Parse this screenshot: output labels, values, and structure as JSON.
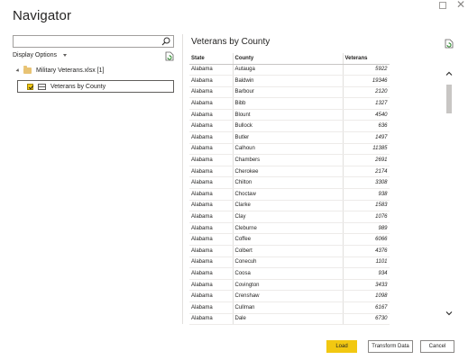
{
  "window": {
    "title": "Navigator",
    "maximize_glyph": "",
    "close_glyph": "✕"
  },
  "search": {
    "placeholder": "",
    "value": ""
  },
  "display_options": {
    "label": "Display Options"
  },
  "tree": {
    "folder_label": "Military Veterans.xlsx [1]",
    "item_label": "Veterans by County",
    "item_checked": true
  },
  "preview": {
    "title": "Veterans by County",
    "columns": [
      "State",
      "County",
      "Veterans"
    ],
    "rows": [
      [
        "Alabama",
        "Autauga",
        "5922"
      ],
      [
        "Alabama",
        "Baldwin",
        "19346"
      ],
      [
        "Alabama",
        "Barbour",
        "2120"
      ],
      [
        "Alabama",
        "Bibb",
        "1327"
      ],
      [
        "Alabama",
        "Blount",
        "4540"
      ],
      [
        "Alabama",
        "Bullock",
        "636"
      ],
      [
        "Alabama",
        "Butler",
        "1497"
      ],
      [
        "Alabama",
        "Calhoun",
        "11385"
      ],
      [
        "Alabama",
        "Chambers",
        "2691"
      ],
      [
        "Alabama",
        "Cherokee",
        "2174"
      ],
      [
        "Alabama",
        "Chilton",
        "3308"
      ],
      [
        "Alabama",
        "Choctaw",
        "938"
      ],
      [
        "Alabama",
        "Clarke",
        "1583"
      ],
      [
        "Alabama",
        "Clay",
        "1076"
      ],
      [
        "Alabama",
        "Cleburne",
        "989"
      ],
      [
        "Alabama",
        "Coffee",
        "6066"
      ],
      [
        "Alabama",
        "Colbert",
        "4376"
      ],
      [
        "Alabama",
        "Conecuh",
        "1101"
      ],
      [
        "Alabama",
        "Coosa",
        "934"
      ],
      [
        "Alabama",
        "Covington",
        "3433"
      ],
      [
        "Alabama",
        "Crenshaw",
        "1098"
      ],
      [
        "Alabama",
        "Cullman",
        "6167"
      ],
      [
        "Alabama",
        "Dale",
        "6730"
      ]
    ]
  },
  "buttons": {
    "load": "Load",
    "transform": "Transform Data",
    "cancel": "Cancel"
  },
  "colors": {
    "accent": "#f2c811",
    "folder": "#e8c374"
  },
  "icons": [
    "search-icon",
    "refresh-icon",
    "folder-icon",
    "table-icon",
    "chevron-up-icon",
    "chevron-down-icon"
  ]
}
